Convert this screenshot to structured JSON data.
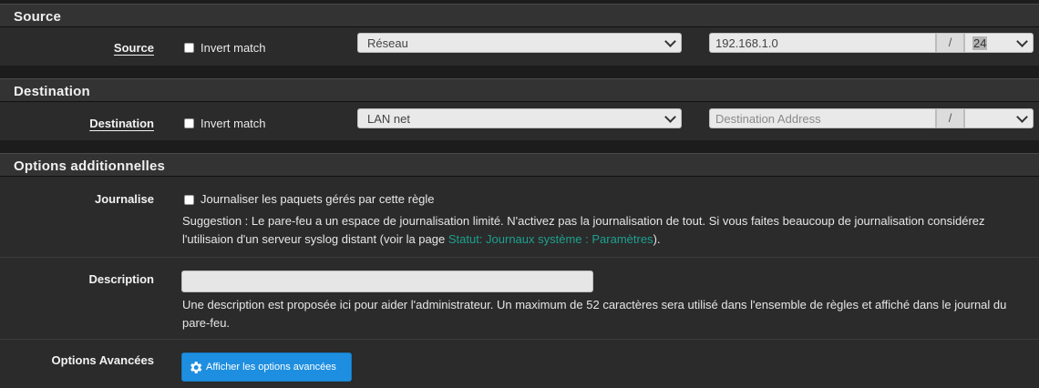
{
  "source": {
    "section_title": "Source",
    "label": "Source",
    "invert_label": "Invert match",
    "type_value": "Réseau",
    "address_value": "192.168.1.0",
    "slash": "/",
    "mask_value": "24"
  },
  "destination": {
    "section_title": "Destination",
    "label": "Destination",
    "invert_label": "Invert match",
    "type_value": "LAN net",
    "address_placeholder": "Destination Address",
    "slash": "/",
    "mask_value": ""
  },
  "options": {
    "section_title": "Options additionnelles",
    "log_label": "Journalise",
    "log_checkbox_label": "Journaliser les paquets gérés par cette règle",
    "log_help_text": "Suggestion : Le pare-feu a un espace de journalisation limité. N'activez pas la journalisation de tout. Si vous faites beaucoup de journalisation considérez l'utilisaion d'un serveur syslog distant (voir la page ",
    "log_help_link": "Statut: Journaux système : Paramètres",
    "log_help_suffix": ").",
    "description_label": "Description",
    "description_value": "",
    "description_help": "Une description est proposée ici pour aider l'administrateur. Un maximum de 52 caractères sera utilisé dans l'ensemble de règles et affiché dans le journal du pare-feu.",
    "advanced_label": "Options Avancées",
    "advanced_button": "Afficher les options avancées",
    "advanced_button_icon": "gear-icon"
  },
  "colors": {
    "accent": "#1e8fe0",
    "link": "#1ea08f",
    "panel_header": "#333333",
    "panel_body": "#2b2b2b"
  }
}
